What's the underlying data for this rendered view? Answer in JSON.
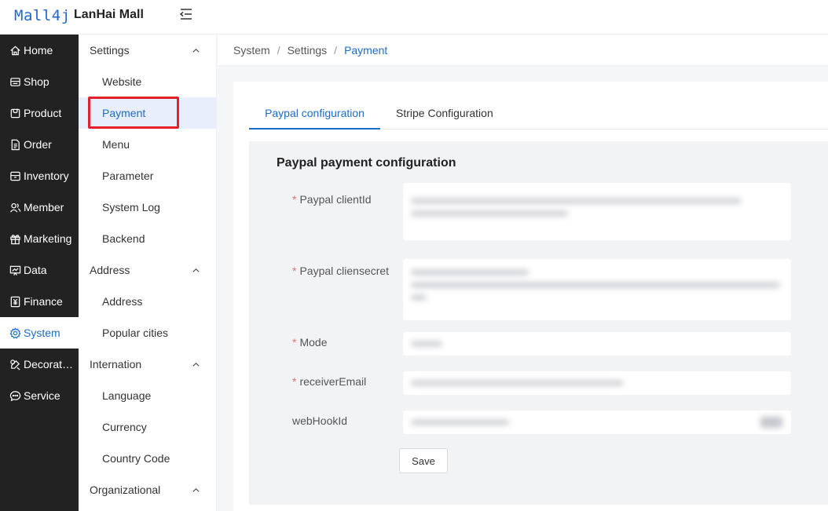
{
  "header": {
    "logo": "Mall4j",
    "brand": "LanHai Mall"
  },
  "leftnav": [
    {
      "label": "Home",
      "icon": "home-icon"
    },
    {
      "label": "Shop",
      "icon": "shop-icon"
    },
    {
      "label": "Product",
      "icon": "product-icon"
    },
    {
      "label": "Order",
      "icon": "order-icon"
    },
    {
      "label": "Inventory",
      "icon": "inventory-icon"
    },
    {
      "label": "Member",
      "icon": "member-icon"
    },
    {
      "label": "Marketing",
      "icon": "gift-icon"
    },
    {
      "label": "Data",
      "icon": "chart-icon"
    },
    {
      "label": "Finance",
      "icon": "finance-icon"
    },
    {
      "label": "System",
      "icon": "gear-icon",
      "active": true
    },
    {
      "label": "Decorat…",
      "icon": "decorate-icon"
    },
    {
      "label": "Service",
      "icon": "chat-icon"
    }
  ],
  "subnav": {
    "settings": {
      "title": "Settings",
      "items": [
        "Website",
        "Payment",
        "Menu",
        "Parameter",
        "System Log",
        "Backend"
      ]
    },
    "address": {
      "title": "Address",
      "items": [
        "Address",
        "Popular cities"
      ]
    },
    "internation": {
      "title": "Internation",
      "items": [
        "Language",
        "Currency",
        "Country Code"
      ]
    },
    "organizational": {
      "title": "Organizational"
    }
  },
  "breadcrumb": {
    "items": [
      "System",
      "Settings"
    ],
    "current": "Payment",
    "separator": "/"
  },
  "tabs": [
    "Paypal configuration",
    "Stripe Configuration"
  ],
  "panel": {
    "title": "Paypal payment configuration",
    "fields": [
      {
        "label": "Paypal clientId",
        "required": true
      },
      {
        "label": "Paypal cliensecret",
        "required": true
      },
      {
        "label": "Mode",
        "required": true
      },
      {
        "label": "receiverEmail",
        "required": true
      },
      {
        "label": "webHookId",
        "required": false
      }
    ],
    "required_mark": "*",
    "save_label": "Save"
  },
  "colors": {
    "accent": "#1b6ccb",
    "sidebar": "#222222",
    "required": "#f56c6c",
    "highlight": "#e3202c"
  }
}
